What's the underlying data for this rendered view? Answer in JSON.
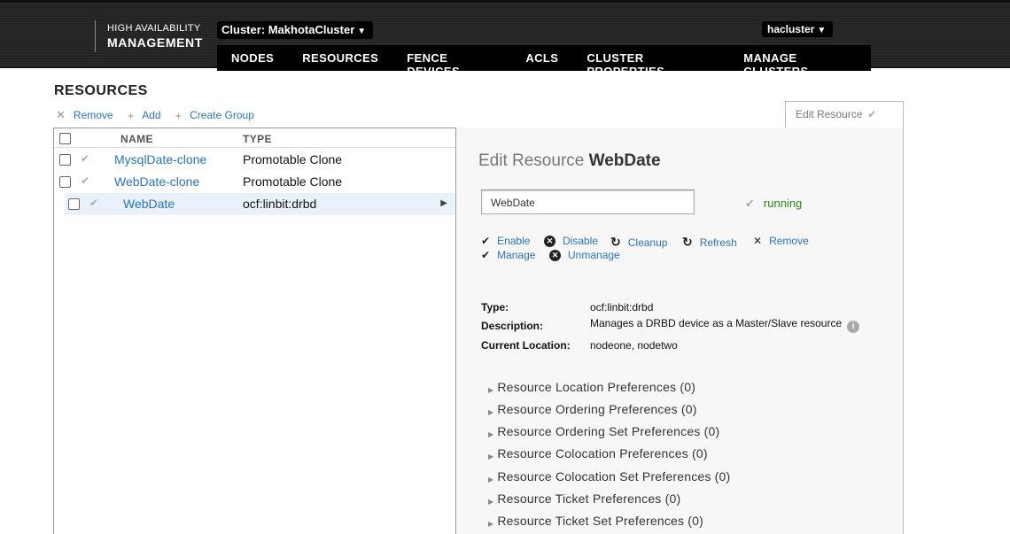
{
  "header": {
    "brand_line1": "HIGH AVAILABILITY",
    "brand_line2": "MANAGEMENT",
    "cluster_selector": "Cluster: MakhotaCluster",
    "user_menu": "hacluster",
    "nav_tabs": [
      "NODES",
      "RESOURCES",
      "FENCE DEVICES",
      "ACLS",
      "CLUSTER PROPERTIES",
      "MANAGE CLUSTERS"
    ]
  },
  "page": {
    "title": "RESOURCES",
    "toolbar": {
      "remove": "Remove",
      "add": "Add",
      "create_group": "Create Group"
    },
    "edit_tab_label": "Edit Resource"
  },
  "resource_list": {
    "columns": {
      "name": "NAME",
      "type": "TYPE"
    },
    "rows": [
      {
        "name": "MysqlDate-clone",
        "type": "Promotable Clone"
      },
      {
        "name": "WebDate-clone",
        "type": "Promotable Clone"
      },
      {
        "name": "WebDate",
        "type": "ocf:linbit:drbd"
      }
    ]
  },
  "detail": {
    "title_prefix": "Edit Resource",
    "title_name": "WebDate",
    "name_value": "WebDate",
    "status": "running",
    "actions": {
      "enable": "Enable",
      "disable": "Disable",
      "cleanup": "Cleanup",
      "refresh": "Refresh",
      "remove": "Remove",
      "manage": "Manage",
      "unmanage": "Unmanage"
    },
    "properties": {
      "type_label": "Type:",
      "type_value": "ocf:linbit:drbd",
      "description_label": "Description:",
      "description_value": "Manages a DRBD device as a Master/Slave resource",
      "location_label": "Current Location:",
      "location_value": "nodeone, nodetwo"
    },
    "preferences": [
      "Resource Location Preferences (0)",
      "Resource Ordering Preferences (0)",
      "Resource Ordering Set Preferences (0)",
      "Resource Colocation Preferences (0)",
      "Resource Colocation Set Preferences (0)",
      "Resource Ticket Preferences (0)",
      "Resource Ticket Set Preferences (0)"
    ]
  },
  "colors": {
    "link": "#2a73c0",
    "running": "#2a8a16",
    "nav_bg": "#000000"
  }
}
